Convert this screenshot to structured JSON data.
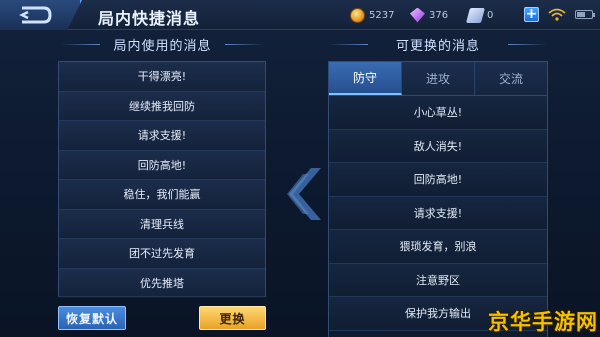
{
  "header": {
    "title": "局内快捷消息",
    "gold": "5237",
    "diamonds": "376",
    "tickets": "0",
    "battery_level": 0.6
  },
  "left_section": {
    "title": "局内使用的消息",
    "items": [
      "干得漂亮!",
      "继续推我回防",
      "请求支援!",
      "回防高地!",
      "稳住，我们能赢",
      "清理兵线",
      "团不过先发育",
      "优先推塔"
    ]
  },
  "right_section": {
    "title": "可更换的消息",
    "tabs": [
      "防守",
      "进攻",
      "交流"
    ],
    "active_tab": "防守",
    "items": [
      "小心草丛!",
      "敌人消失!",
      "回防高地!",
      "请求支援!",
      "猥琐发育，别浪",
      "注意野区",
      "保护我方输出"
    ]
  },
  "buttons": {
    "reset": "恢复默认",
    "swap": "更换"
  },
  "watermark": "京华手游网",
  "colors": {
    "accent_blue": "#3a6cb4",
    "gold_button": "#e8a225",
    "watermark": "#f2c100"
  }
}
